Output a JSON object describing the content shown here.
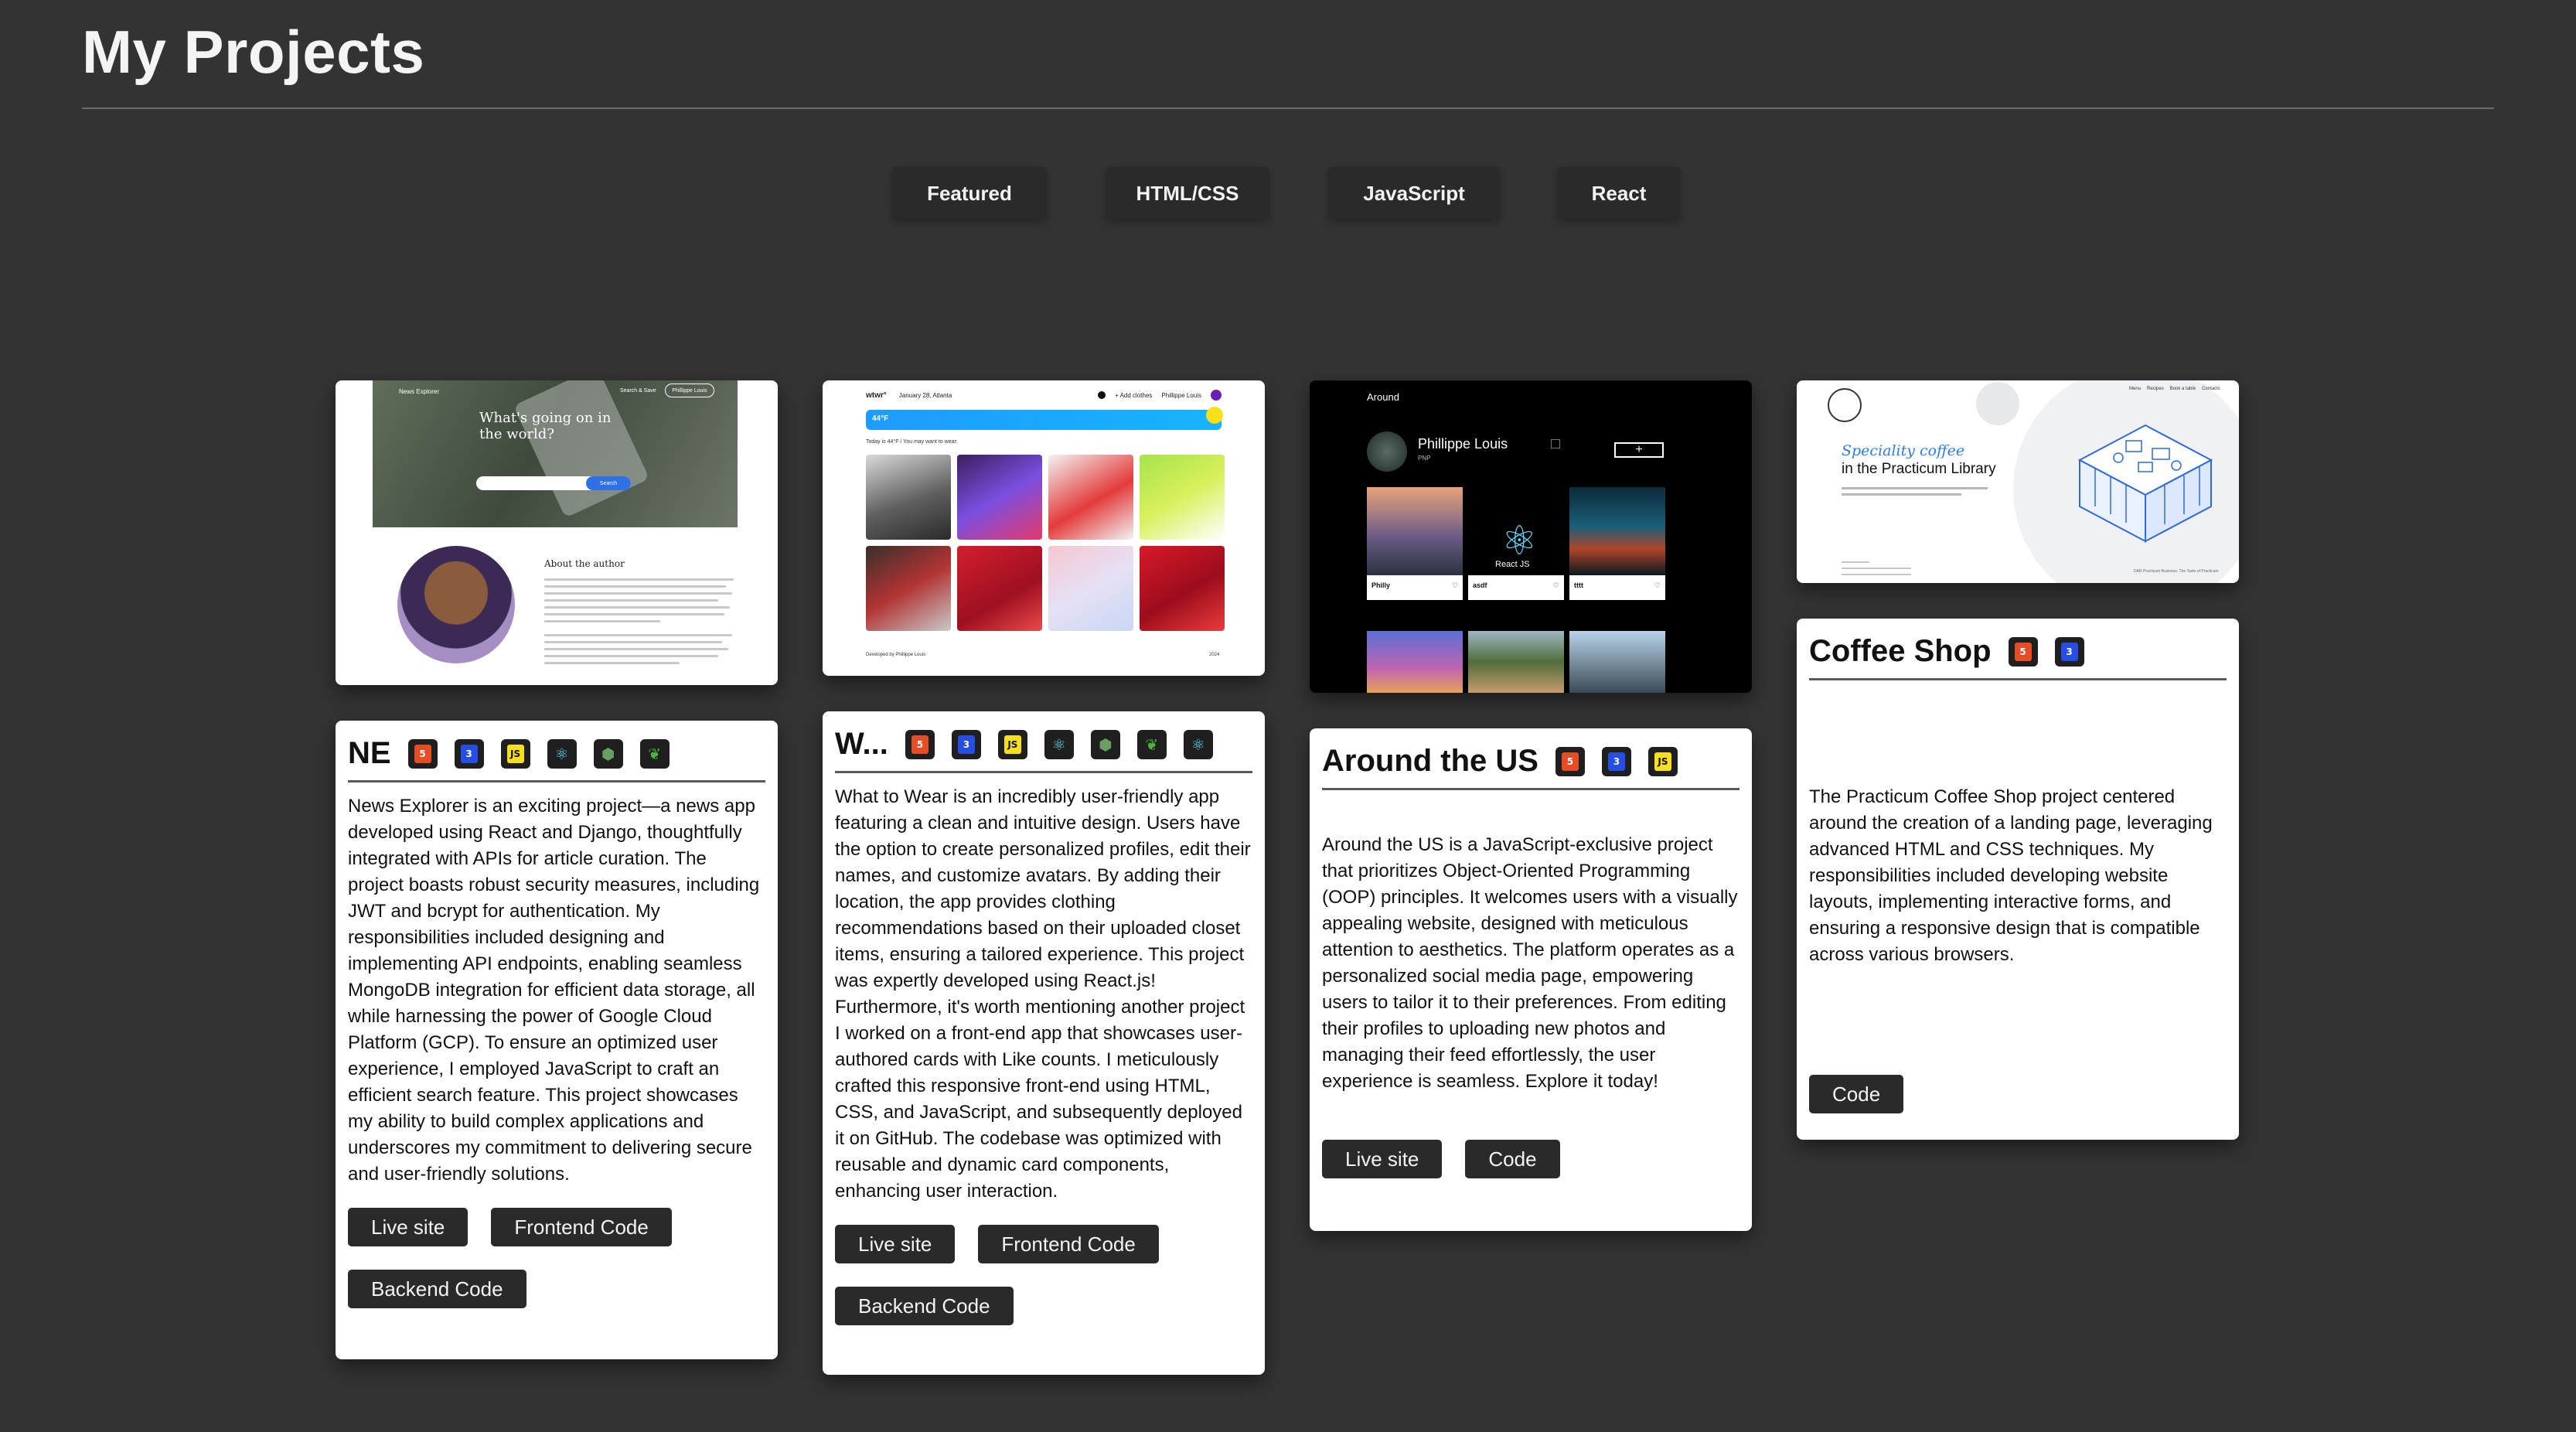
{
  "header": {
    "title": "My Projects"
  },
  "filters": [
    {
      "label": "Featured"
    },
    {
      "label": "HTML/CSS"
    },
    {
      "label": "JavaScript"
    },
    {
      "label": "React"
    }
  ],
  "projects": [
    {
      "title": "NE",
      "tech_icons": [
        "html5-icon",
        "css3-icon",
        "javascript-icon",
        "react-icon",
        "nodejs-icon",
        "mongodb-icon"
      ],
      "description": "News Explorer is an exciting project—a news app developed using React and Django, thoughtfully integrated with APIs for article curation. The project boasts robust security measures, including JWT and bcrypt for authentication. My responsibilities included designing and implementing API endpoints, enabling seamless MongoDB integration for efficient data storage, all while harnessing the power of Google Cloud Platform (GCP). To ensure an optimized user experience, I employed JavaScript to craft an efficient search feature. This project showcases my ability to build complex applications and underscores my commitment to delivering secure and user-friendly solutions.",
      "buttons": [
        "Live site",
        "Frontend Code",
        "Backend Code"
      ],
      "preview": {
        "brand": "News Explorer",
        "headline": "What's going on in the world?",
        "nav_link": "Search & Save",
        "nav_button": "Phillippe Louis",
        "search_button": "Search",
        "about_title": "About the author"
      }
    },
    {
      "title": "W...",
      "tech_icons": [
        "html5-icon",
        "css3-icon",
        "javascript-icon",
        "react-icon",
        "nodejs-icon",
        "mongodb-icon",
        "react-icon"
      ],
      "description": "What to Wear is an incredibly user-friendly app featuring a clean and intuitive design. Users have the option to create personalized profiles, edit their names, and customize avatars. By adding their location, the app provides clothing recommendations based on their uploaded closet items, ensuring a tailored experience. This project was expertly developed using React.js! Furthermore, it's worth mentioning another project I worked on a front-end app that showcases user-authored cards with Like counts. I meticulously crafted this responsive front-end using HTML, CSS, and JavaScript, and subsequently deployed it on GitHub. The codebase was optimized with reusable and dynamic card components, enhancing user interaction.",
      "buttons": [
        "Live site",
        "Frontend Code",
        "Backend Code"
      ],
      "preview": {
        "brand": "wtwr°",
        "date": "January 28, Atlanta",
        "add_clothes": "+ Add clothes",
        "user": "Phillippe Louis",
        "temp": "44°F",
        "note": "Today is 44°F / You may want to wear:",
        "footer_left": "Developed by Phillippe Louis",
        "footer_right": "2024"
      }
    },
    {
      "title": "Around the US",
      "tech_icons": [
        "html5-icon",
        "css3-icon",
        "javascript-icon"
      ],
      "description": "Around the US is a JavaScript-exclusive project that prioritizes Object-Oriented Programming (OOP) principles. It welcomes users with a visually appealing website, designed with meticulous attention to aesthetics. The platform operates as a personalized social media page, empowering users to tailor it to their preferences. From editing their profiles to uploading new photos and managing their feed effortlessly, the user experience is seamless. Explore it today!",
      "buttons": [
        "Live site",
        "Code"
      ],
      "preview": {
        "logo": "Around",
        "name": "Phillippe Louis",
        "subtitle": "PNP",
        "add": "+",
        "captions": [
          "Philly",
          "asdf",
          "tttt"
        ],
        "react_label": "React JS"
      }
    },
    {
      "title": "Coffee Shop",
      "tech_icons": [
        "html5-icon",
        "css3-icon"
      ],
      "description": "The Practicum Coffee Shop project centered around the creation of a landing page, leveraging advanced HTML and CSS techniques. My responsibilities included developing website layouts, implementing interactive forms, and ensuring a responsive design that is compatible across various browsers.",
      "buttons": [
        "Code"
      ],
      "preview": {
        "nav": [
          "Menu",
          "Recipes",
          "Book a table",
          "Contacts"
        ],
        "headline_italic": "Speciality coffee",
        "headline": "in the Practicum Library",
        "footer": "DAR Practicum Business. The Taste of Practicum"
      }
    }
  ],
  "colors": {
    "background": "#333333",
    "button": "#2a2a2a",
    "card": "#ffffff",
    "html": "#e44d26",
    "css": "#264de4",
    "js": "#f7df1e",
    "react": "#61dafb",
    "accent_blue": "#2f7de0"
  }
}
